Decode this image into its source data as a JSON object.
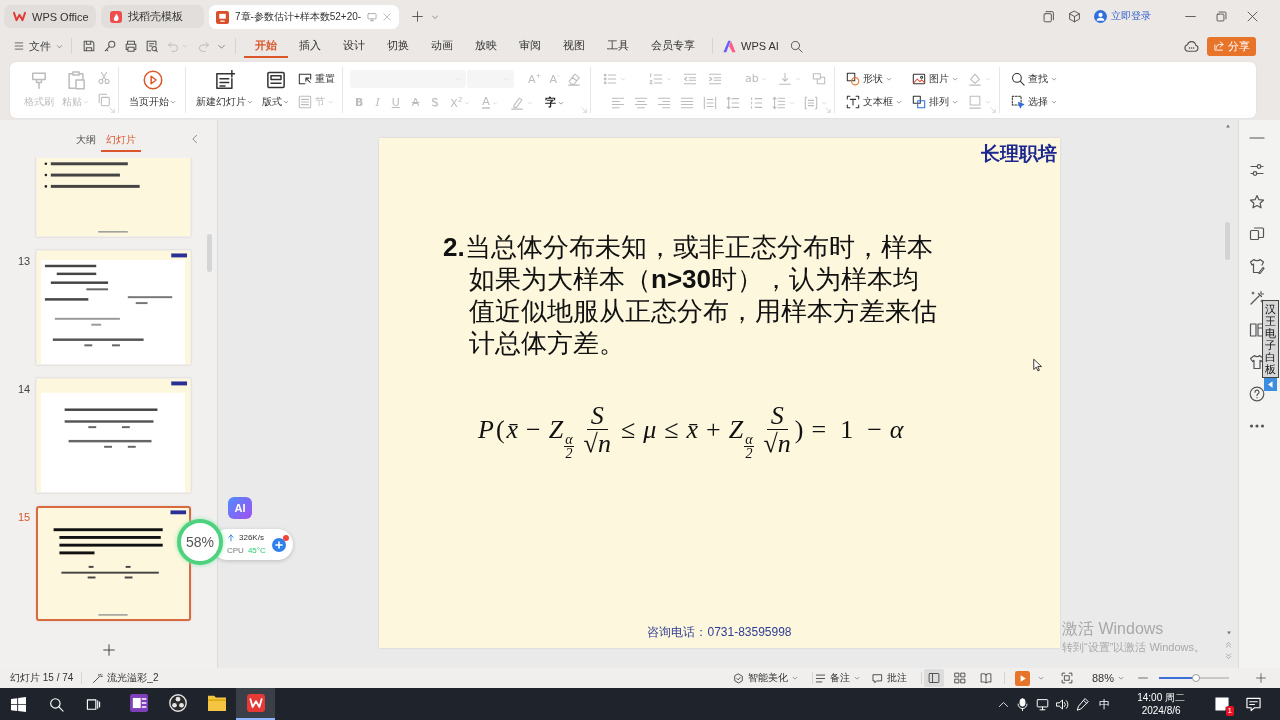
{
  "title_bar": {
    "tabs": [
      {
        "kind": "home",
        "label": "WPS Office",
        "selected": false
      },
      {
        "kind": "templates",
        "label": "找稻壳模板",
        "selected": false
      },
      {
        "kind": "document",
        "label": "7章-参数估计+样本数52+20-",
        "selected": true
      }
    ],
    "login": "立即登录"
  },
  "menu_bar": {
    "file": "文件",
    "tabs": [
      {
        "label": "开始",
        "selected": true
      },
      {
        "label": "插入",
        "selected": false
      },
      {
        "label": "设计",
        "selected": false
      },
      {
        "label": "切换",
        "selected": false
      },
      {
        "label": "动画",
        "selected": false
      },
      {
        "label": "放映",
        "selected": false
      },
      {
        "label": "审阅",
        "selected": false
      },
      {
        "label": "视图",
        "selected": false
      },
      {
        "label": "工具",
        "selected": false
      },
      {
        "label": "会员专享",
        "selected": false
      }
    ],
    "ai": "WPS AI",
    "share": "分享"
  },
  "ribbon": {
    "groups": [
      {
        "kind": "columns",
        "items": [
          {
            "kind": "large",
            "label": "格式刷",
            "disabled": true,
            "dropdown": false
          },
          {
            "kind": "large",
            "label": "粘贴",
            "disabled": true,
            "dropdown": true
          },
          {
            "kind": "small",
            "disabled": true,
            "dropdown": false
          },
          {
            "kind": "small",
            "disabled": true,
            "dropdown": false
          }
        ]
      },
      {
        "kind": "columns",
        "items": [
          {
            "kind": "large",
            "label": "当页开始",
            "disabled": false,
            "dropdown": true
          }
        ]
      },
      {
        "kind": "columns",
        "items": [
          {
            "kind": "large",
            "label": "新建幻灯片",
            "disabled": false,
            "dropdown": true
          },
          {
            "kind": "large",
            "label": "版式",
            "disabled": false,
            "dropdown": true
          },
          {
            "kind": "small",
            "label": "重置",
            "disabled": false,
            "dropdown": false
          },
          {
            "kind": "small",
            "label": "节",
            "disabled": true,
            "dropdown": true
          }
        ]
      },
      {
        "kind": "stacked",
        "top": [
          {
            "kind": "field",
            "disabled": true,
            "dropdown": true
          },
          {
            "kind": "field",
            "disabled": true,
            "dropdown": true
          },
          {
            "kind": "text",
            "label": "A$^{+}$",
            "disabled": true,
            "dropdown": false
          },
          {
            "kind": "text",
            "label": "A$^{-}$",
            "disabled": true,
            "dropdown": false
          },
          {
            "kind": "icon",
            "disabled": true,
            "dropdown": false
          }
        ],
        "bottom": [
          {
            "kind": "bold",
            "label": "B",
            "disabled": true,
            "dropdown": false
          },
          {
            "kind": "italic",
            "label": "I",
            "disabled": true,
            "dropdown": false
          },
          {
            "kind": "underline",
            "label": "U",
            "disabled": true,
            "dropdown": false
          },
          {
            "kind": "strike",
            "label": "A",
            "disabled": true,
            "dropdown": false
          },
          {
            "kind": "shadow",
            "label": "S",
            "disabled": true,
            "dropdown": false
          },
          {
            "kind": "text",
            "label": "X$^{2}$",
            "disabled": true,
            "dropdown": true
          },
          {
            "kind": "color",
            "label": "A",
            "disabled": true,
            "dropdown": true
          },
          {
            "kind": "icon",
            "disabled": true,
            "dropdown": true
          },
          {
            "kind": "text",
            "label": "字",
            "disabled": false,
            "dropdown": true
          }
        ]
      },
      {
        "kind": "stacked",
        "top": [
          {
            "kind": "icon",
            "disabled": true,
            "dropdown": true
          },
          {
            "kind": "icon",
            "disabled": true,
            "dropdown": true
          },
          {
            "kind": "icon",
            "disabled": true,
            "dropdown": false
          },
          {
            "kind": "icon",
            "disabled": true,
            "dropdown": false
          },
          {
            "kind": "text",
            "label": "ab",
            "disabled": true,
            "dropdown": true
          },
          {
            "kind": "icon",
            "disabled": true,
            "dropdown": true
          },
          {
            "kind": "icon",
            "disabled": true,
            "dropdown": false
          }
        ],
        "bottom": [
          {
            "kind": "icon",
            "disabled": true,
            "dropdown": false
          },
          {
            "kind": "icon",
            "disabled": true,
            "dropdown": false
          },
          {
            "kind": "icon",
            "disabled": true,
            "dropdown": false
          },
          {
            "kind": "icon",
            "disabled": true,
            "dropdown": false
          },
          {
            "kind": "icon",
            "disabled": true,
            "dropdown": false
          },
          {
            "kind": "icon",
            "disabled": true,
            "dropdown": false
          },
          {
            "kind": "icon",
            "disabled": true,
            "dropdown": false
          },
          {
            "kind": "icon",
            "disabled": true,
            "dropdown": true
          },
          {
            "kind": "icon",
            "disabled": true,
            "dropdown": true
          }
        ]
      },
      {
        "kind": "columns",
        "items": [
          {
            "kind": "small",
            "label": "形状",
            "disabled": false,
            "dropdown": true
          },
          {
            "kind": "small",
            "label": "文本框",
            "disabled": false,
            "dropdown": true
          },
          {
            "kind": "small",
            "label": "图片",
            "disabled": false,
            "dropdown": true
          },
          {
            "kind": "small",
            "label": "排列",
            "disabled": false,
            "dropdown": true
          },
          {
            "kind": "small",
            "disabled": true,
            "dropdown": true
          },
          {
            "kind": "small",
            "disabled": true,
            "dropdown": true
          }
        ]
      },
      {
        "kind": "columns",
        "items": [
          {
            "kind": "small",
            "label": "查找",
            "disabled": false,
            "dropdown": true
          },
          {
            "kind": "small",
            "label": "选择",
            "disabled": false,
            "dropdown": true
          }
        ]
      }
    ]
  },
  "panel": {
    "tabs": [
      {
        "label": "大纲",
        "selected": false
      },
      {
        "label": "幻灯片",
        "selected": true
      }
    ],
    "slides": [
      {
        "kind": "bullets",
        "selected": false
      },
      {
        "number": "13",
        "kind": "formulas",
        "selected": false
      },
      {
        "number": "14",
        "kind": "formula-card",
        "selected": false
      },
      {
        "number": "15",
        "kind": "text-formula",
        "selected": true
      }
    ]
  },
  "slide": {
    "logo": "长理职培",
    "body": "**2.**当总体分布未知，或非正态分布时，样本如果为大样本（**n>30**时），认为样本均值近似地服从正态分布，用样本方差来估计总体方差。",
    "formula": [
      {
        "kind": "var",
        "text": "P"
      },
      {
        "kind": "op",
        "text": "("
      },
      {
        "kind": "var",
        "text": "x̄"
      },
      {
        "kind": "op",
        "text": "−"
      },
      {
        "kind": "var",
        "text": "Z"
      },
      {
        "kind": "sub",
        "num": "α",
        "den": "2"
      },
      {
        "kind": "frac",
        "num": "S",
        "den": "√n"
      },
      {
        "kind": "op",
        "text": "≤"
      },
      {
        "kind": "var",
        "text": "μ"
      },
      {
        "kind": "op",
        "text": "≤"
      },
      {
        "kind": "var",
        "text": "x̄"
      },
      {
        "kind": "op",
        "text": "+"
      },
      {
        "kind": "var",
        "text": "Z"
      },
      {
        "kind": "sub",
        "num": "α",
        "den": "2"
      },
      {
        "kind": "frac",
        "num": "S",
        "den": "√n"
      },
      {
        "kind": "op",
        "text": ")"
      },
      {
        "kind": "op",
        "text": "="
      },
      {
        "kind": "op",
        "text": "1"
      },
      {
        "kind": "op",
        "text": "−"
      },
      {
        "kind": "var",
        "text": "α"
      }
    ],
    "footer": "咨询电话：0731-83595998"
  },
  "whiteboard": {
    "label": "汉王电子白板"
  },
  "monitor": {
    "ai": "AI",
    "load": "58%",
    "upload": "326K/s",
    "cpu_label": "CPU",
    "cpu_temp": "45°C"
  },
  "activation": {
    "title": "激活 Windows",
    "hint": "转到“设置”以激活 Windows。"
  },
  "status_bar": {
    "slide_counter": "幻灯片 15 / 74",
    "theme": "流光溢彩_2",
    "beautify": "智能美化",
    "notes": "备注",
    "comments": "批注",
    "views": [
      {
        "selected": true
      },
      {
        "selected": false
      },
      {
        "selected": false
      }
    ],
    "zoom": "88%",
    "zoom_slider": {
      "level": 0.53
    }
  },
  "taskbar": {
    "apps": [
      {
        "selected": false
      },
      {
        "selected": false
      },
      {
        "selected": false
      },
      {
        "selected": true
      }
    ],
    "ime": "中",
    "time": "14:00 周二",
    "date": "2024/8/6",
    "notifications": "1"
  }
}
